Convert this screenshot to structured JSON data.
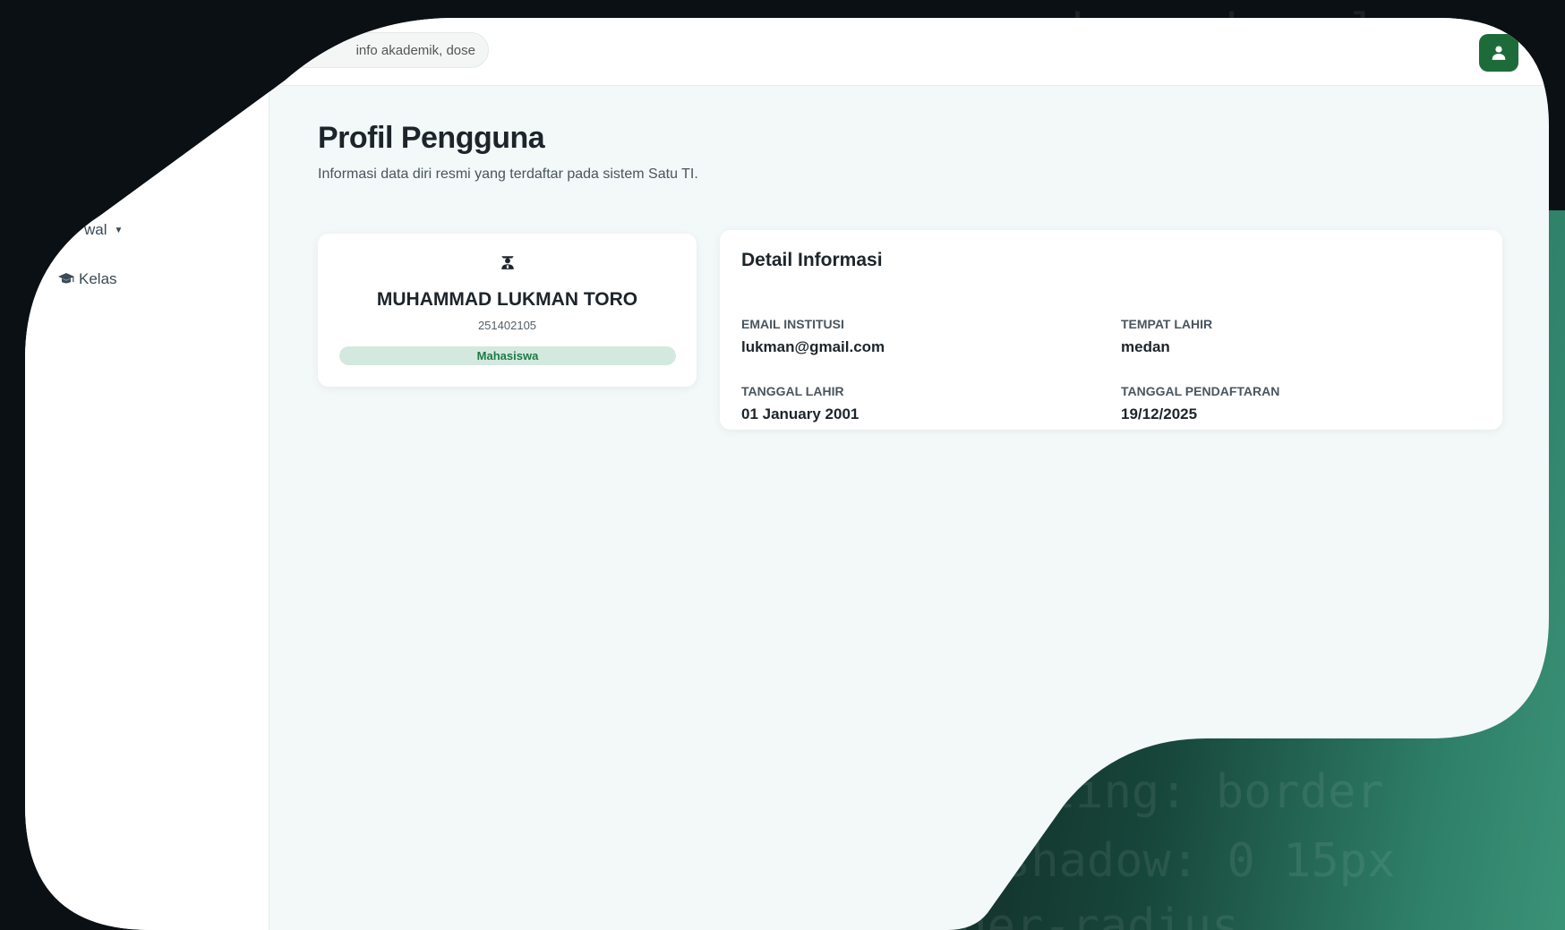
{
  "header": {
    "search_placeholder": "Cari info akademik, dosen...",
    "search_visible_text": "info akademik, dose"
  },
  "sidebar": {
    "items": [
      {
        "label": "Jadwal",
        "visible_label": "wal",
        "has_dropdown": true,
        "icon": "caret-down-icon"
      },
      {
        "label": "Kelas",
        "icon": "graduation-cap-icon"
      }
    ]
  },
  "page": {
    "title": "Profil Pengguna",
    "subtitle": "Informasi data diri resmi yang terdaftar pada sistem Satu TI."
  },
  "profile": {
    "icon": "student-icon",
    "name": "MUHAMMAD LUKMAN TORO",
    "nim": "251402105",
    "role": "Mahasiswa"
  },
  "details": {
    "title": "Detail Informasi",
    "fields": [
      {
        "label": "EMAIL INSTITUSI",
        "value": "lukman@gmail.com"
      },
      {
        "label": "TEMPAT LAHIR",
        "value": "medan"
      },
      {
        "label": "TANGGAL LAHIR",
        "value": "01 January 2001"
      },
      {
        "label": "TANGGAL PENDAFTARAN",
        "value": "19/12/2025"
      }
    ]
  },
  "background_code": [
    "zing: border",
    "shadow: 0 15px",
    "rder-radius",
    "kgrund: url"
  ],
  "colors": {
    "accent_green": "#1e6b3a",
    "badge_bg": "#d3e9df",
    "badge_text": "#1f7a45",
    "page_bg": "#f3f8f8",
    "backdrop": "#0b1014"
  }
}
